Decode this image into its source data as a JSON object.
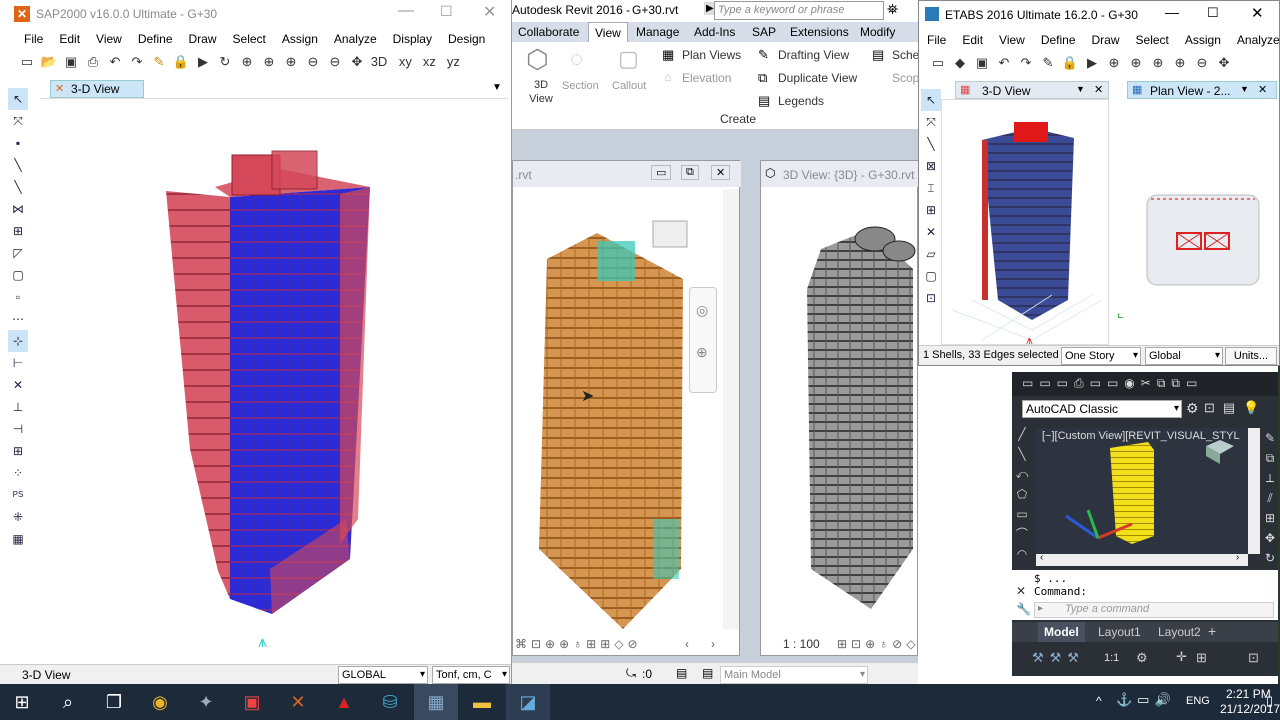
{
  "sap": {
    "title": "SAP2000 v16.0.0 Ultimate  - G+30",
    "menu": [
      "File",
      "Edit",
      "View",
      "Define",
      "Draw",
      "Select",
      "Assign",
      "Analyze",
      "Display",
      "Design"
    ],
    "toolbar": [
      "xy",
      "xz",
      "yz"
    ],
    "tab": "3-D View",
    "status_left": "3-D View",
    "coord_system": "GLOBAL",
    "units": "Tonf, cm, C"
  },
  "revit": {
    "title": "Autodesk Revit 2016 -",
    "file": "G+30.rvt",
    "search_placeholder": "Type a keyword or phrase",
    "tabs": [
      "Collaborate",
      "View",
      "Manage",
      "Add-Ins",
      "SAP",
      "Extensions",
      "Modify"
    ],
    "active_tab": "View",
    "ribbon": {
      "view3d": "3D View",
      "section": "Section",
      "callout": "Callout",
      "plan_views": "Plan Views",
      "elevation": "Elevation",
      "drafting_view": "Drafting View",
      "duplicate_view": "Duplicate View",
      "legends": "Legends",
      "schedules": "Sche",
      "scope": "Scop",
      "panel": "Create"
    },
    "view1_title": ".rvt",
    "view2_title": "3D View: {3D} - G+30.rvt",
    "scale": "1 : 100",
    "status_value": ":0",
    "model": "Main Model"
  },
  "etabs": {
    "title": "ETABS 2016 Ultimate 16.2.0 - G+30",
    "menu": [
      "File",
      "Edit",
      "View",
      "Define",
      "Draw",
      "Select",
      "Assign",
      "Analyze"
    ],
    "tab1": "3-D View",
    "tab2": "Plan View - 2...",
    "status": "1 Shells, 33 Edges selected",
    "story": "One Story",
    "global": "Global",
    "units": "Units..."
  },
  "autocad": {
    "workspace": "AutoCAD Classic",
    "viewport_label": "[−][Custom View][REVIT_VISUAL_STYL",
    "history1": "$ ...",
    "history2": "Command:",
    "command_placeholder": "Type a command",
    "layout_tabs": [
      "Model",
      "Layout1",
      "Layout2"
    ],
    "scale": "1:1"
  },
  "taskbar": {
    "lang": "ENG",
    "time": "2:21 PM",
    "date": "21/12/2017"
  },
  "colors": {
    "sap_red": "#d4485a",
    "sap_blue": "#2b2bd8",
    "revit_orange": "#c87a2a",
    "revit_cyan": "#3cc8b8",
    "etabs_blue": "#3b4b98",
    "acad_yellow": "#f2e01a",
    "taskbar": "#1c2a3a"
  }
}
